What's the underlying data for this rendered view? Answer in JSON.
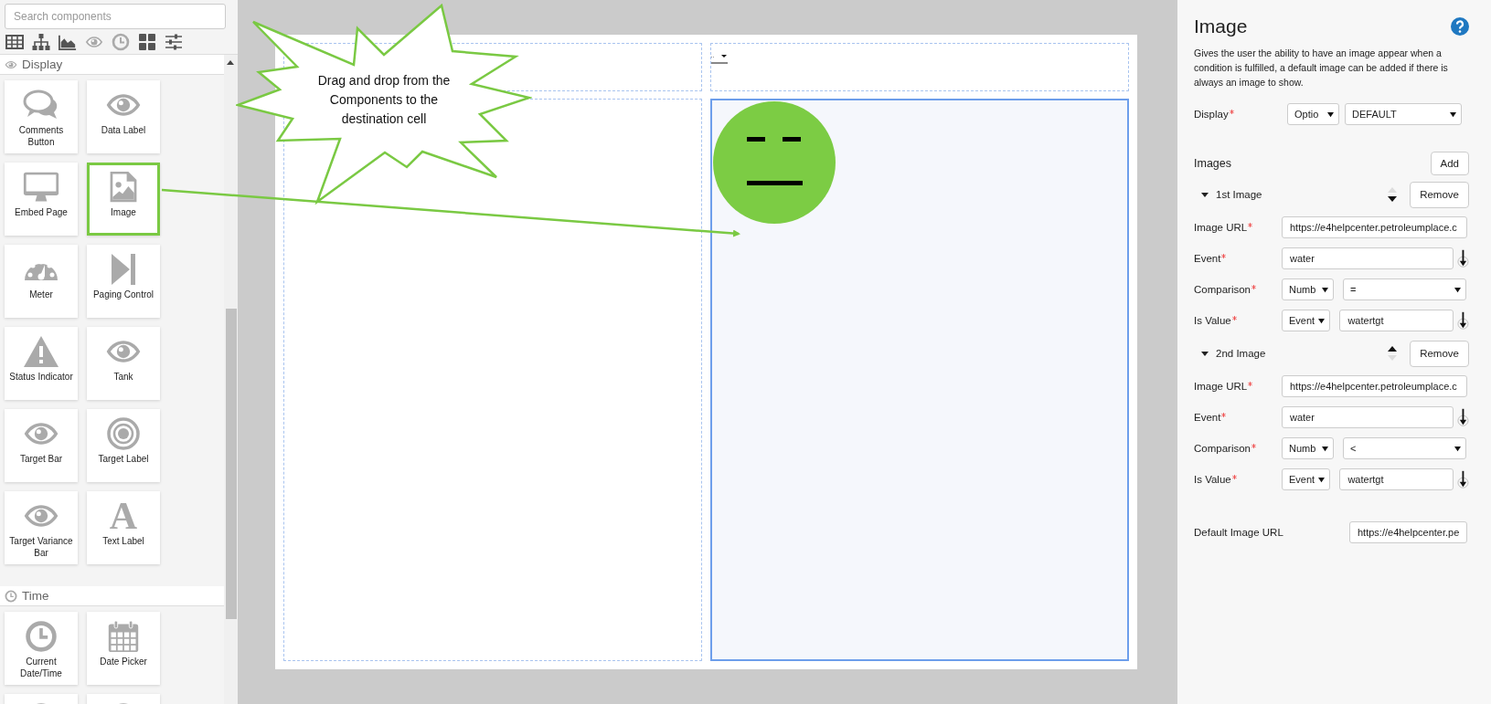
{
  "sidebar": {
    "search": {
      "placeholder": "Search components"
    },
    "toolbar": [
      {
        "kind": "table"
      },
      {
        "kind": "sitemap"
      },
      {
        "kind": "areachart"
      },
      {
        "kind": "eye"
      },
      {
        "kind": "clock"
      },
      {
        "kind": "grid"
      },
      {
        "kind": "sliders"
      }
    ],
    "sections": [
      {
        "title": "Display",
        "kind": "eye",
        "rows": [
          [
            {
              "label": "Comments Button",
              "kind": "comments",
              "selected": false
            },
            {
              "label": "Data Label",
              "kind": "eye",
              "selected": false
            }
          ],
          [
            {
              "label": "Embed Page",
              "kind": "monitor",
              "selected": false
            },
            {
              "label": "Image",
              "kind": "image",
              "selected": true
            }
          ],
          [
            {
              "label": "Meter",
              "kind": "meter",
              "selected": false
            },
            {
              "label": "Paging Control",
              "kind": "paging",
              "selected": false
            }
          ],
          [
            {
              "label": "Status Indicator",
              "kind": "warning",
              "selected": false
            },
            {
              "label": "Tank",
              "kind": "eye",
              "selected": false
            }
          ],
          [
            {
              "label": "Target Bar",
              "kind": "eye",
              "selected": false
            },
            {
              "label": "Target Label",
              "kind": "target",
              "selected": false
            }
          ],
          [
            {
              "label": "Target Variance Bar",
              "kind": "eye",
              "selected": false
            },
            {
              "label": "Text Label",
              "kind": "glyph",
              "glyph": "A",
              "selected": false
            }
          ]
        ]
      },
      {
        "title": "Time",
        "kind": "clock",
        "rows": [
          [
            {
              "label": "Current Date/Time",
              "kind": "clock",
              "selected": false
            },
            {
              "label": "Date Picker",
              "kind": "calendar",
              "selected": false
            }
          ],
          [
            {
              "kind": "clock",
              "selected": false
            },
            {
              "kind": "clock",
              "selected": false
            }
          ]
        ]
      }
    ]
  },
  "canvas": {
    "callout": "Drag and drop from the Components to the destination cell",
    "cells": [
      {
        "selected": false,
        "kind": "empty"
      },
      {
        "selected": false,
        "kind": "dropdown"
      },
      {
        "selected": false,
        "kind": "empty"
      },
      {
        "selected": true,
        "kind": "emoji"
      }
    ]
  },
  "panel": {
    "title": "Image",
    "description": "Gives the user the ability to have an image appear when a condition is fulfilled, a default image can be added if there is always an image to show.",
    "display": {
      "label": "Display",
      "required": true,
      "controls": [
        {
          "kind": "select",
          "value": "Optio"
        },
        {
          "kind": "select",
          "value": "DEFAULT"
        }
      ]
    },
    "images_heading": "Images",
    "add_button": "Add",
    "images": [
      {
        "title": "1st Image",
        "expanded": true,
        "up_enabled": false,
        "down_enabled": true,
        "remove_button": "Remove",
        "fields": [
          {
            "label": "Image URL",
            "required": true,
            "picker": false,
            "controls": [
              {
                "kind": "input",
                "value": "https://e4helpcenter.petroleumplace.c"
              }
            ]
          },
          {
            "label": "Event",
            "required": true,
            "picker": true,
            "controls": [
              {
                "kind": "input",
                "value": "water"
              }
            ]
          },
          {
            "label": "Comparison",
            "required": true,
            "picker": false,
            "controls": [
              {
                "kind": "select",
                "value": "Numb"
              },
              {
                "kind": "select",
                "value": "="
              }
            ]
          },
          {
            "label": "Is Value",
            "required": true,
            "picker": true,
            "controls": [
              {
                "kind": "select",
                "value": "Event"
              },
              {
                "kind": "input",
                "value": "watertgt"
              }
            ]
          }
        ]
      },
      {
        "title": "2nd Image",
        "expanded": true,
        "up_enabled": true,
        "down_enabled": false,
        "remove_button": "Remove",
        "fields": [
          {
            "label": "Image URL",
            "required": true,
            "picker": false,
            "controls": [
              {
                "kind": "input",
                "value": "https://e4helpcenter.petroleumplace.c"
              }
            ]
          },
          {
            "label": "Event",
            "required": true,
            "picker": true,
            "controls": [
              {
                "kind": "input",
                "value": "water"
              }
            ]
          },
          {
            "label": "Comparison",
            "required": true,
            "picker": false,
            "controls": [
              {
                "kind": "select",
                "value": "Numb"
              },
              {
                "kind": "select",
                "value": "<"
              }
            ]
          },
          {
            "label": "Is Value",
            "required": true,
            "picker": true,
            "controls": [
              {
                "kind": "select",
                "value": "Event"
              },
              {
                "kind": "input",
                "value": "watertgt"
              }
            ]
          }
        ]
      }
    ],
    "default_url": {
      "label": "Default Image URL",
      "required": false,
      "value": "https://e4helpcenter.pe"
    }
  }
}
